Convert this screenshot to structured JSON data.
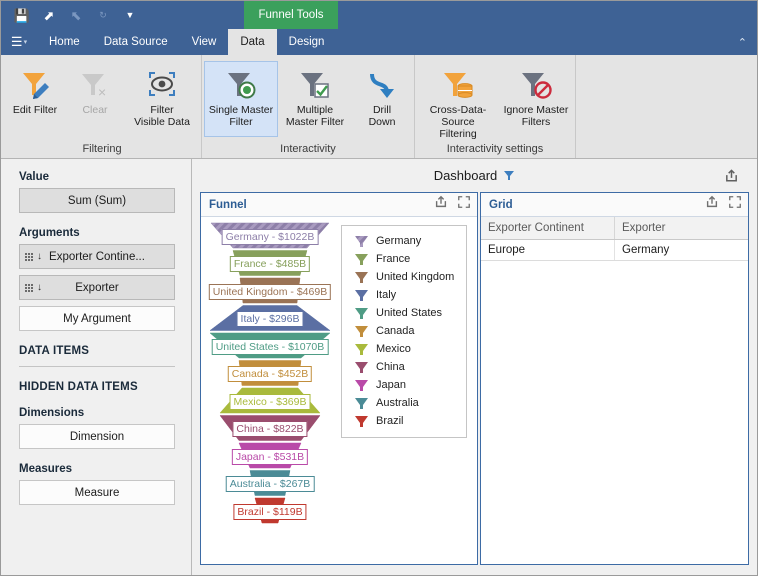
{
  "titlebar": {
    "qat": [
      {
        "name": "save-icon",
        "glyph": "💾"
      },
      {
        "name": "undo-icon",
        "glyph": "⬈"
      },
      {
        "name": "redo-icon",
        "glyph": "⬉"
      },
      {
        "name": "refresh-icon",
        "glyph": "↻"
      },
      {
        "name": "qat-dropdown-icon",
        "glyph": "▼"
      }
    ],
    "context_tab": "Funnel Tools"
  },
  "tabs": {
    "app_menu_label": "☰",
    "items": [
      {
        "label": "Home",
        "active": false
      },
      {
        "label": "Data Source",
        "active": false
      },
      {
        "label": "View",
        "active": false
      },
      {
        "label": "Data",
        "active": true
      },
      {
        "label": "Design",
        "active": false
      }
    ],
    "collapse_icon": "⌃"
  },
  "ribbon": {
    "groups": [
      {
        "label": "Filtering",
        "buttons": [
          {
            "name": "edit-filter-button",
            "label": "Edit Filter",
            "icon": "filter-edit-icon",
            "state": "normal"
          },
          {
            "name": "clear-filter-button",
            "label": "Clear",
            "icon": "filter-clear-icon",
            "state": "disabled"
          },
          {
            "name": "filter-visible-data-button",
            "label": "Filter\nVisible Data",
            "icon": "eye-crop-icon",
            "state": "normal"
          }
        ]
      },
      {
        "label": "Interactivity",
        "buttons": [
          {
            "name": "single-master-filter-button",
            "label": "Single Master\nFilter",
            "icon": "funnel-dot-icon",
            "state": "selected"
          },
          {
            "name": "multiple-master-filter-button",
            "label": "Multiple\nMaster Filter",
            "icon": "funnel-check-icon",
            "state": "normal"
          },
          {
            "name": "drill-down-button",
            "label": "Drill\nDown",
            "icon": "drill-down-arrow-icon",
            "state": "normal"
          }
        ]
      },
      {
        "label": "Interactivity settings",
        "buttons": [
          {
            "name": "cross-data-source-filtering-button",
            "label": "Cross-Data-Source\nFiltering",
            "icon": "funnel-database-icon",
            "state": "normal"
          },
          {
            "name": "ignore-master-filters-button",
            "label": "Ignore Master\nFilters",
            "icon": "funnel-block-icon",
            "state": "normal"
          }
        ]
      }
    ]
  },
  "left_panel": {
    "sections": [
      {
        "title": "Value",
        "items": [
          {
            "label": "Sum (Sum)",
            "style": "filled",
            "lead": "none"
          }
        ]
      },
      {
        "title": "Arguments",
        "items": [
          {
            "label": "Exporter Contine...",
            "style": "filled",
            "lead": "sort"
          },
          {
            "label": "Exporter",
            "style": "filled",
            "lead": "sort"
          },
          {
            "label": "My Argument",
            "style": "empty",
            "lead": "none"
          }
        ]
      },
      {
        "title": "DATA ITEMS",
        "items": []
      },
      {
        "title": "HIDDEN DATA ITEMS",
        "items": []
      },
      {
        "title": "Dimensions",
        "items": [
          {
            "label": "Dimension",
            "style": "empty",
            "lead": "none"
          }
        ]
      },
      {
        "title": "Measures",
        "items": [
          {
            "label": "Measure",
            "style": "empty",
            "lead": "none"
          }
        ]
      }
    ]
  },
  "dashboard": {
    "title": "Dashboard",
    "filter_icon": "funnel-icon",
    "export_icon": "export-icon"
  },
  "funnel_widget": {
    "title": "Funnel",
    "export_icon": "export-icon",
    "maximize_icon": "maximize-icon"
  },
  "grid_widget": {
    "title": "Grid",
    "export_icon": "export-icon",
    "maximize_icon": "maximize-icon",
    "columns": [
      "Exporter Continent",
      "Exporter"
    ],
    "rows": [
      [
        "Europe",
        "Germany"
      ]
    ]
  },
  "chart_data": {
    "type": "funnel",
    "title": "Funnel",
    "value_label": "Sum (Sum)",
    "argument_label": "Exporter",
    "currency_prefix": "$",
    "unit_suffix": "B",
    "categories": [
      "Germany",
      "France",
      "United Kingdom",
      "Italy",
      "United States",
      "Canada",
      "Mexico",
      "China",
      "Japan",
      "Australia",
      "Brazil"
    ],
    "values": [
      1022,
      485,
      469,
      296,
      1070,
      452,
      369,
      822,
      531,
      267,
      119
    ],
    "labels": [
      "Germany - $1022B",
      "France - $485B",
      "United Kingdom - $469B",
      "Italy - $296B",
      "United States - $1070B",
      "Canada - $452B",
      "Mexico - $369B",
      "China - $822B",
      "Japan - $531B",
      "Australia - $267B",
      "Brazil - $119B"
    ],
    "colors": [
      "#8d7fa8",
      "#87a05c",
      "#9a7355",
      "#5b6fa3",
      "#4f9c85",
      "#c18e3c",
      "#a9ba3c",
      "#9a4d6e",
      "#b94aa8",
      "#4b8b96",
      "#c0392f"
    ],
    "selected_index": 0,
    "legend": {
      "position": "right",
      "entries": [
        "Germany",
        "France",
        "United Kingdom",
        "Italy",
        "United States",
        "Canada",
        "Mexico",
        "China",
        "Japan",
        "Australia",
        "Brazil"
      ]
    },
    "geometry_top_widths": [
      118,
      74,
      60,
      54,
      120,
      62,
      56,
      100,
      62,
      40,
      30
    ],
    "geometry_bottom_widths": [
      74,
      60,
      54,
      120,
      62,
      56,
      100,
      62,
      40,
      30,
      16
    ]
  }
}
